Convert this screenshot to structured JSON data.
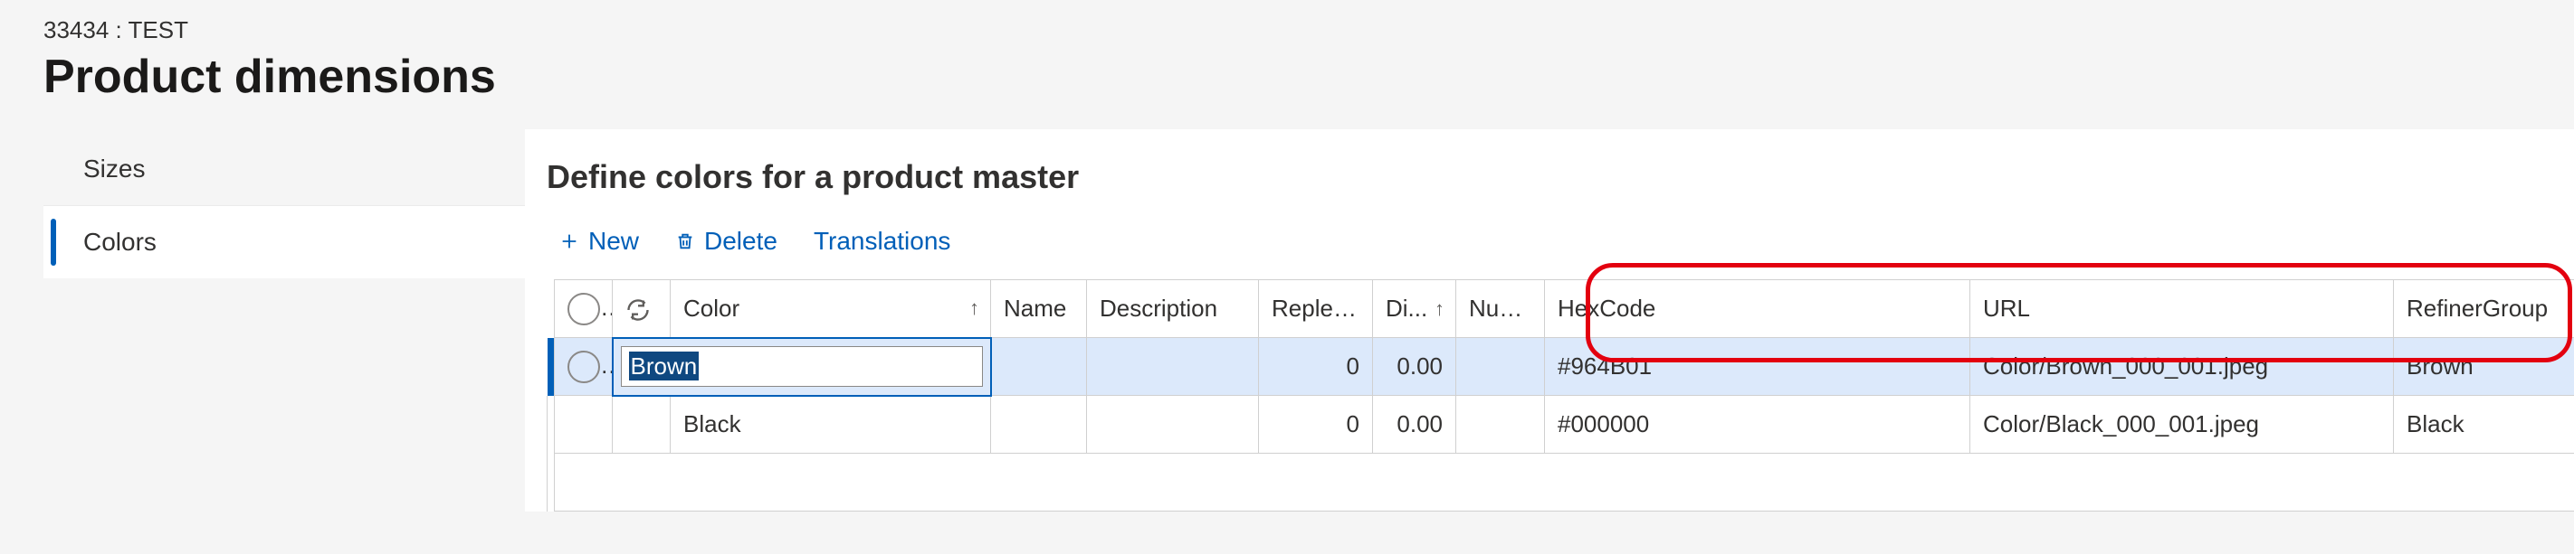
{
  "header": {
    "breadcrumb": "33434 : TEST",
    "title": "Product dimensions"
  },
  "sidebar": {
    "items": [
      {
        "label": "Sizes",
        "active": false
      },
      {
        "label": "Colors",
        "active": true
      }
    ]
  },
  "main": {
    "section_title": "Define colors for a product master",
    "toolbar": {
      "new_label": "New",
      "delete_label": "Delete",
      "translations_label": "Translations"
    },
    "grid": {
      "columns": {
        "color": "Color",
        "name": "Name",
        "description": "Description",
        "replenishment": "Repleni...",
        "dimension": "Di...",
        "number": "Num...",
        "hexcode": "HexCode",
        "url": "URL",
        "refinergroup": "RefinerGroup"
      },
      "rows": [
        {
          "selected": true,
          "color": "Brown",
          "name": "",
          "description": "",
          "replenishment": "0",
          "dimension": "0.00",
          "number": "",
          "hexcode": "#964B01",
          "url": "Color/Brown_000_001.jpeg",
          "refinergroup": "Brown"
        },
        {
          "selected": false,
          "color": "Black",
          "name": "",
          "description": "",
          "replenishment": "0",
          "dimension": "0.00",
          "number": "",
          "hexcode": "#000000",
          "url": "Color/Black_000_001.jpeg",
          "refinergroup": "Black"
        }
      ]
    }
  }
}
